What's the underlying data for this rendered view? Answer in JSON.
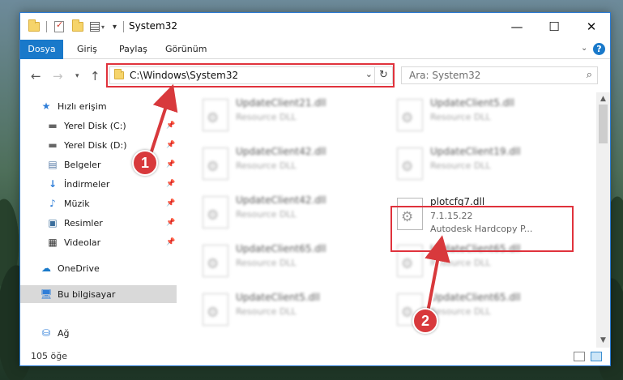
{
  "window": {
    "title": "System32"
  },
  "ribbon": {
    "tabs": [
      {
        "label": "Dosya"
      },
      {
        "label": "Giriş"
      },
      {
        "label": "Paylaş"
      },
      {
        "label": "Görünüm"
      }
    ],
    "help": "?"
  },
  "address": {
    "path": "C:\\Windows\\System32"
  },
  "search": {
    "placeholder": "Ara: System32"
  },
  "sidebar": {
    "quick_access": "Hızlı erişim",
    "items": [
      {
        "label": "Yerel Disk (C:)",
        "icon": "drive-c-icon"
      },
      {
        "label": "Yerel Disk (D:)",
        "icon": "drive-d-icon"
      },
      {
        "label": "Belgeler",
        "icon": "documents-icon"
      },
      {
        "label": "İndirmeler",
        "icon": "downloads-icon"
      },
      {
        "label": "Müzik",
        "icon": "music-icon"
      },
      {
        "label": "Resimler",
        "icon": "pictures-icon"
      },
      {
        "label": "Videolar",
        "icon": "videos-icon"
      }
    ],
    "onedrive": "OneDrive",
    "this_pc": "Bu bilgisayar",
    "network": "Ağ"
  },
  "files": {
    "col1": [
      {
        "name": "UpdateClient21.dll",
        "desc": "Resource DLL"
      },
      {
        "name": "UpdateClient42.dll",
        "desc": "Resource DLL"
      },
      {
        "name": "UpdateClient42.dll",
        "desc": "Resource DLL"
      },
      {
        "name": "UpdateClient65.dll",
        "desc": "Resource DLL"
      },
      {
        "name": "UpdateClient5.dll",
        "desc": "Resource DLL"
      }
    ],
    "col2": [
      {
        "name": "UpdateClient5.dll",
        "desc": "Resource DLL"
      },
      {
        "name": "UpdateClient19.dll",
        "desc": "Resource DLL"
      },
      {
        "name": "UpdateClient65.dll",
        "desc": "Resource DLL"
      },
      {
        "name": "UpdateClient65.dll",
        "desc": "Resource DLL"
      }
    ],
    "highlighted": {
      "name": "plotcfg7.dll",
      "version": "7.1.15.22",
      "desc": "Autodesk Hardcopy P..."
    }
  },
  "status": {
    "count": "105 öğe"
  },
  "callouts": {
    "one": "1",
    "two": "2"
  },
  "colors": {
    "accent": "#1979ca",
    "highlight": "#e0323c"
  }
}
